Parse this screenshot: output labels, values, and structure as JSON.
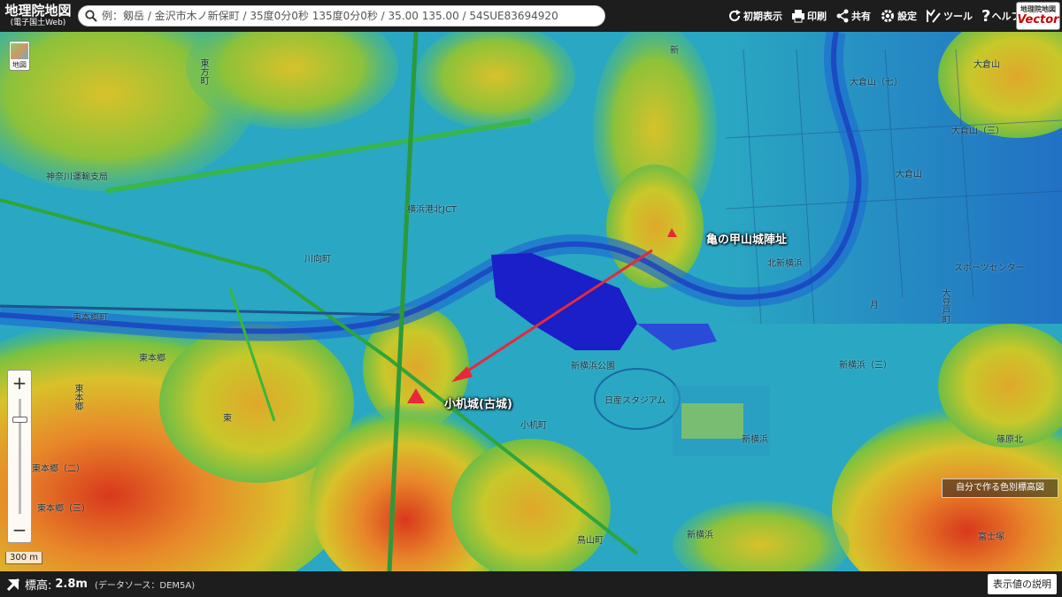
{
  "header": {
    "logo_main": "地理院地図",
    "logo_sub": "(電子国土Web)",
    "search_placeholder": "例：剱岳 / 金沢市木ノ新保町 / 35度0分0秒 135度0分0秒 / 35.00 135.00 / 54SUE83694920",
    "tools": {
      "reset": "初期表示",
      "print": "印刷",
      "share": "共有",
      "settings": "設定",
      "tools": "ツール",
      "help": "ヘルプ"
    },
    "badge_top": "地理院地図",
    "badge_bottom": "Vector"
  },
  "map": {
    "layer_button_label": "地図",
    "annotations": {
      "kamenokoyama": "亀の甲山城陣址",
      "kozukue": "小机城(古城)"
    },
    "towns": {
      "higashikata": "東方町",
      "kanagawa_unyu": "神奈川運輸支局",
      "kawamukai": "川向町",
      "higashihongo_cho": "東本郷町",
      "higashihongo_1": "東本郷",
      "higashihongo_2": "東本郷",
      "higashihongo_3": "東本郷（三）",
      "higashihongo_4": "東本郷（二）",
      "higashi": "東",
      "yokohama_kohoku_jct": "横浜港北JCT",
      "shinyokohama_park": "新横浜公園",
      "nissan_stadium": "日産スタジアム",
      "kozukue_cho": "小机町",
      "toriyama_cho": "鳥山町",
      "kitashinyokohama": "北新横浜",
      "shinyokohama": "新横浜",
      "shinyokohama_3": "新横浜（三）",
      "shinyokohama_2": "新横浜",
      "okurayama": "大倉山",
      "okurayama_7": "大倉山（七）",
      "okurayama_3": "大倉山（三）",
      "okurayama_2": "大倉山",
      "sports_center": "スポーツセンター",
      "kitashin": "新",
      "shinohara_kita": "篠原北",
      "fujizuka": "富士塚",
      "tsuki": "月",
      "ohmamedo": "大豆戸町"
    },
    "legend_button": "自分で作る色別標高図",
    "scale_label": "300 m"
  },
  "footer": {
    "elevation_label": "標高:",
    "elevation_value": "2.8m",
    "source": "(データソース：DEM5A)",
    "explain_button": "表示値の説明"
  },
  "colors": {
    "lowland": "#2aa7c2",
    "water_deep": "#1a1fc8",
    "annotation_marker": "#e8283a",
    "arrow": "#e8283a"
  }
}
